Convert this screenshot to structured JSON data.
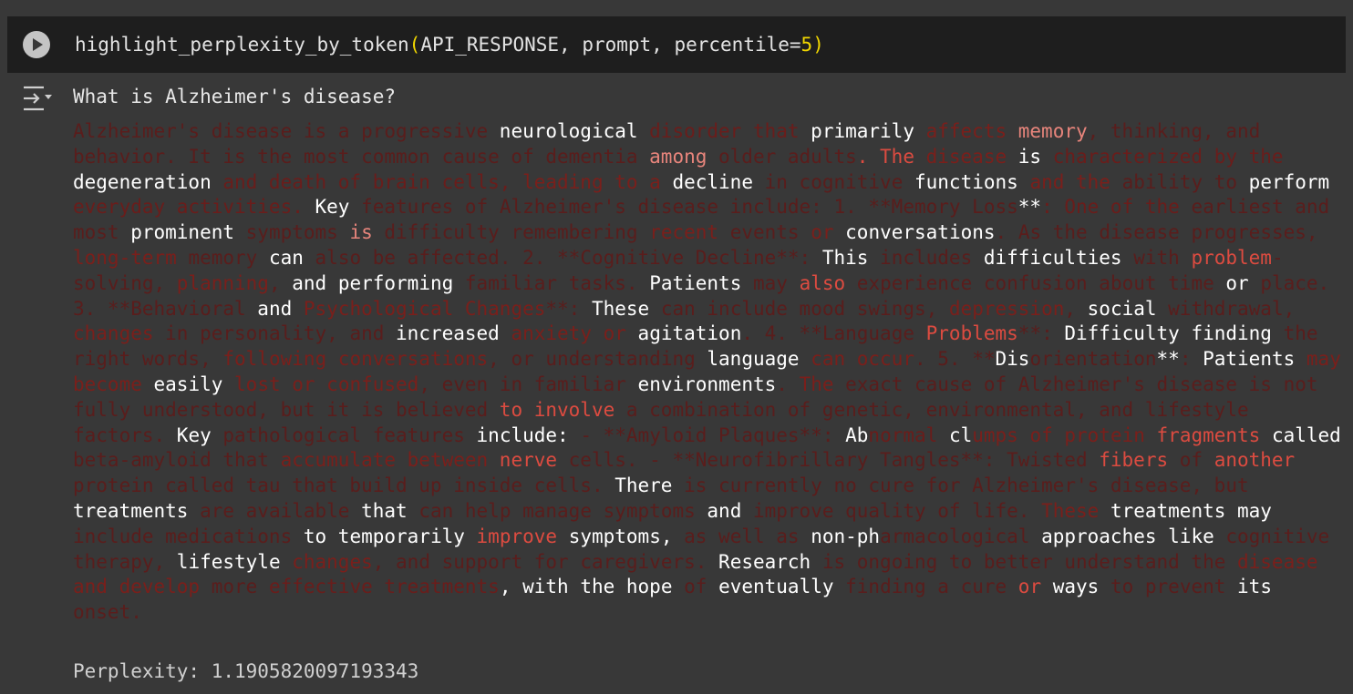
{
  "code_cell": {
    "fn_name": "highlight_perplexity_by_token",
    "open_paren": "(",
    "args_text": "API_RESPONSE, prompt, percentile=",
    "percentile_value": "5",
    "close_paren": ")",
    "run_icon": "play-icon"
  },
  "output": {
    "icon": "output-collapse-icon",
    "prompt": "What is Alzheimer's disease?",
    "perplexity_label": "Perplexity: 1.1905820097193343"
  },
  "colors": {
    "white": "#ffffff",
    "red1": "#e8857c",
    "red2": "#dc4b40",
    "red3": "#b02a22",
    "red4": "#7a1f1b",
    "red5": "#6a1d1b",
    "red6": "#5a1d1c"
  },
  "tokens": [
    [
      "Alzheimer's disease is a progressive ",
      "red6"
    ],
    [
      "neurological",
      "white"
    ],
    [
      " disorder that ",
      "red5"
    ],
    [
      "primarily",
      "white"
    ],
    [
      " affects ",
      "red4"
    ],
    [
      "memory",
      "red1"
    ],
    [
      ", thinking, and behavior. It is the most common cause of dementia ",
      "red6"
    ],
    [
      "among",
      "red1"
    ],
    [
      " older adults",
      "red6"
    ],
    [
      ". The ",
      "red2"
    ],
    [
      "disease",
      "red4"
    ],
    [
      " is ",
      "white"
    ],
    [
      "characterized by the ",
      "red5"
    ],
    [
      "degeneration",
      "white"
    ],
    [
      " and death of brain cells, ",
      "red5"
    ],
    [
      "leading to a ",
      "red4"
    ],
    [
      "decline",
      "white"
    ],
    [
      " in cognitive ",
      "red6"
    ],
    [
      "functions",
      "white"
    ],
    [
      " and the ",
      "red4"
    ],
    [
      "ability to ",
      "red6"
    ],
    [
      "perform",
      "white"
    ],
    [
      " everyday activities. ",
      "red5"
    ],
    [
      "Key",
      "white"
    ],
    [
      " features of Alzheimer's disease include: 1. **Memory Loss",
      "red6"
    ],
    [
      "**",
      "white"
    ],
    [
      ": One of the ",
      "red5"
    ],
    [
      "earliest and most ",
      "red6"
    ],
    [
      "prominent",
      "white"
    ],
    [
      " symptoms ",
      "red6"
    ],
    [
      "is ",
      "red1"
    ],
    [
      "difficulty remembering ",
      "red6"
    ],
    [
      "recent ",
      "red4"
    ],
    [
      "events ",
      "red6"
    ],
    [
      "or ",
      "red4"
    ],
    [
      "conversations",
      "white"
    ],
    [
      ". As the disease progresses, ",
      "red6"
    ],
    [
      "long-term ",
      "red4"
    ],
    [
      "memory ",
      "red6"
    ],
    [
      "can",
      "white"
    ],
    [
      " also be affected. 2. **Cognitive Decline**: ",
      "red6"
    ],
    [
      "This",
      "white"
    ],
    [
      " includes ",
      "red6"
    ],
    [
      "difficulties",
      "white"
    ],
    [
      " with ",
      "red6"
    ],
    [
      "problem",
      "red2"
    ],
    [
      "-solving, ",
      "red6"
    ],
    [
      "planning",
      "red4"
    ],
    [
      ", ",
      "red6"
    ],
    [
      "and performing ",
      "white"
    ],
    [
      "familiar tasks. ",
      "red6"
    ],
    [
      "Patients",
      "white"
    ],
    [
      " may ",
      "red6"
    ],
    [
      "also ",
      "red2"
    ],
    [
      "experience confusion about time ",
      "red6"
    ],
    [
      "or",
      "white"
    ],
    [
      " place. 3. **Behavioral ",
      "red6"
    ],
    [
      "and ",
      "white"
    ],
    [
      "Psychological Changes",
      "red4"
    ],
    [
      "**: ",
      "red6"
    ],
    [
      "These",
      "white"
    ],
    [
      " can include mood swings, ",
      "red6"
    ],
    [
      "depression",
      "red4"
    ],
    [
      ", ",
      "red6"
    ],
    [
      "social",
      "white"
    ],
    [
      " withdrawal, ",
      "red6"
    ],
    [
      "changes",
      "red4"
    ],
    [
      " in personality, and ",
      "red6"
    ],
    [
      "increased",
      "white"
    ],
    [
      " anxiety or ",
      "red4"
    ],
    [
      "agitation",
      "white"
    ],
    [
      ". 4. **Language ",
      "red6"
    ],
    [
      "Problems",
      "red2"
    ],
    [
      "**: ",
      "red6"
    ],
    [
      "Difficulty finding",
      "white"
    ],
    [
      " the right words, ",
      "red6"
    ],
    [
      "following conversations",
      "red4"
    ],
    [
      ", or understanding ",
      "red6"
    ],
    [
      "language",
      "white"
    ],
    [
      " can occur",
      "red4"
    ],
    [
      ". 5. **",
      "red6"
    ],
    [
      "Dis",
      "white"
    ],
    [
      "orientation",
      "red6"
    ],
    [
      "**",
      "white"
    ],
    [
      ": ",
      "red6"
    ],
    [
      "Patients ",
      "white"
    ],
    [
      "may become ",
      "red4"
    ],
    [
      "easily ",
      "white"
    ],
    [
      "lost or confused",
      "red4"
    ],
    [
      ", even in familiar ",
      "red6"
    ],
    [
      "environments",
      "white"
    ],
    [
      ". ",
      "red6"
    ],
    [
      "The",
      "red4"
    ],
    [
      " exact cause of Alzheimer's disease is not fully understood, but it is believed ",
      "red6"
    ],
    [
      "to involve",
      "red2"
    ],
    [
      " a combination of genetic, environmental, and lifestyle factors. ",
      "red6"
    ],
    [
      "Key",
      "white"
    ],
    [
      " pathological features ",
      "red6"
    ],
    [
      "include:",
      "white"
    ],
    [
      " - **Amyloid Plaques**: ",
      "red6"
    ],
    [
      "Ab",
      "white"
    ],
    [
      "normal ",
      "red5"
    ],
    [
      "cl",
      "white"
    ],
    [
      "umps of protein ",
      "red4"
    ],
    [
      "fragments ",
      "red2"
    ],
    [
      "called ",
      "white"
    ],
    [
      "beta-amyloid that ",
      "red6"
    ],
    [
      "accumulate between ",
      "red4"
    ],
    [
      "nerve ",
      "red2"
    ],
    [
      "cells. - **Neurofibrillary Tangles**: Twisted ",
      "red6"
    ],
    [
      "fibers",
      "red2"
    ],
    [
      " of ",
      "red6"
    ],
    [
      "another",
      "red2"
    ],
    [
      " protein called tau that build up inside cells. ",
      "red6"
    ],
    [
      "There",
      "white"
    ],
    [
      " is currently no cure for Alzheimer's disease, but ",
      "red6"
    ],
    [
      "treatments",
      "white"
    ],
    [
      " are available ",
      "red6"
    ],
    [
      "that",
      "white"
    ],
    [
      " can help manage symptoms ",
      "red6"
    ],
    [
      "and",
      "white"
    ],
    [
      " improve quality of life. ",
      "red6"
    ],
    [
      "These ",
      "red4"
    ],
    [
      "treatments ",
      "white"
    ],
    [
      "may",
      "white"
    ],
    [
      " include medications ",
      "red6"
    ],
    [
      "to temporarily ",
      "white"
    ],
    [
      "improve ",
      "red2"
    ],
    [
      "symptoms,",
      "white"
    ],
    [
      " as well as ",
      "red6"
    ],
    [
      "non-ph",
      "white"
    ],
    [
      "armacological ",
      "red6"
    ],
    [
      "approaches like",
      "white"
    ],
    [
      " cognitive therapy, ",
      "red6"
    ],
    [
      "lifestyle ",
      "white"
    ],
    [
      "changes",
      "red4"
    ],
    [
      ", and support for caregivers. ",
      "red6"
    ],
    [
      "Research",
      "white"
    ],
    [
      " is ongoing to better understand the ",
      "red6"
    ],
    [
      "disease and develop ",
      "red4"
    ],
    [
      "more ",
      "red6"
    ],
    [
      "effective treatments",
      "red5"
    ],
    [
      ", ",
      "white"
    ],
    [
      "with the hope",
      "white"
    ],
    [
      " of ",
      "red6"
    ],
    [
      "eventually",
      "white"
    ],
    [
      " finding a cure ",
      "red6"
    ],
    [
      "or ",
      "red2"
    ],
    [
      "ways",
      "white"
    ],
    [
      " to prevent ",
      "red6"
    ],
    [
      "its",
      "white"
    ],
    [
      " onset.",
      "red6"
    ]
  ]
}
